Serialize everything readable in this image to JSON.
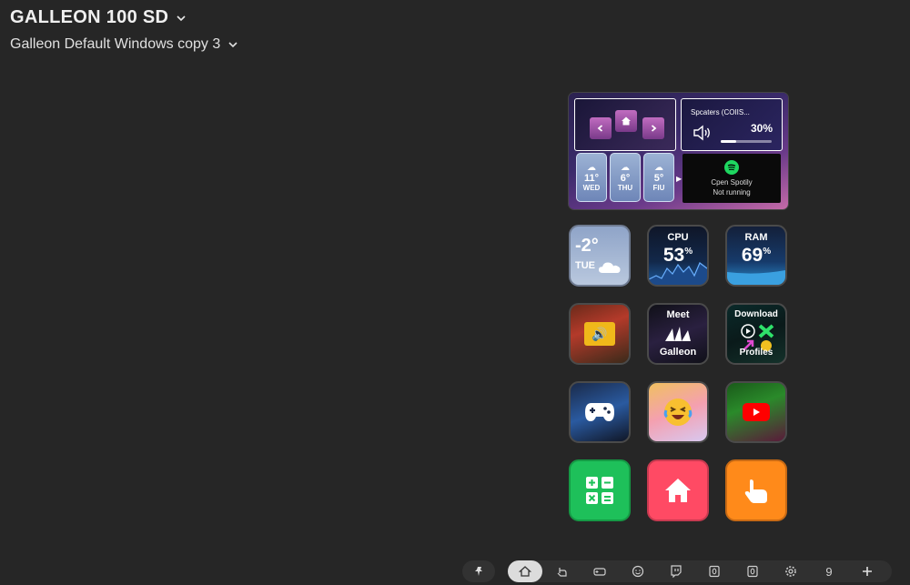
{
  "header": {
    "device_name": "GALLEON 100 SD",
    "profile_name": "Galleon Default Windows copy 3"
  },
  "widgets": {
    "navigation": {
      "prev_icon": "chevron-left-icon",
      "home_icon": "home-icon",
      "next_icon": "chevron-right-icon"
    },
    "volume": {
      "app_name": "Spcaters (COIIS...",
      "percent_label": "30%",
      "level": 0.3
    },
    "weather_forecast": [
      {
        "temp": "11°",
        "day": "WED"
      },
      {
        "temp": "6°",
        "day": "THU"
      },
      {
        "temp": "5°",
        "day": "FIU"
      }
    ],
    "spotify": {
      "line1": "Cpen Spotily",
      "line2": "Not running"
    }
  },
  "keys": {
    "weather": {
      "temp": "-2°",
      "day": "TUE"
    },
    "cpu": {
      "label": "CPU",
      "value": "53",
      "unit": "%"
    },
    "ram": {
      "label": "RAM",
      "value": "69",
      "unit": "%"
    },
    "meet": {
      "top": "Meet",
      "bottom": "Galleon"
    },
    "download": {
      "top": "Download",
      "bottom": "Profiles"
    }
  },
  "toolbar": {
    "tabs": [
      "pin-icon",
      "home-icon",
      "touch-icon",
      "gamepad-icon",
      "smiley-icon",
      "twitch-icon",
      "zero-icon",
      "zero-icon",
      "gear-icon",
      "9",
      "plus-icon"
    ],
    "page_number": "9"
  },
  "colors": {
    "background": "#262626",
    "calc_key": "#1ec05a",
    "home_key": "#ff4a64",
    "touch_key": "#ff8a1a",
    "spotify_green": "#1ed760",
    "youtube_red": "#ff0000"
  }
}
